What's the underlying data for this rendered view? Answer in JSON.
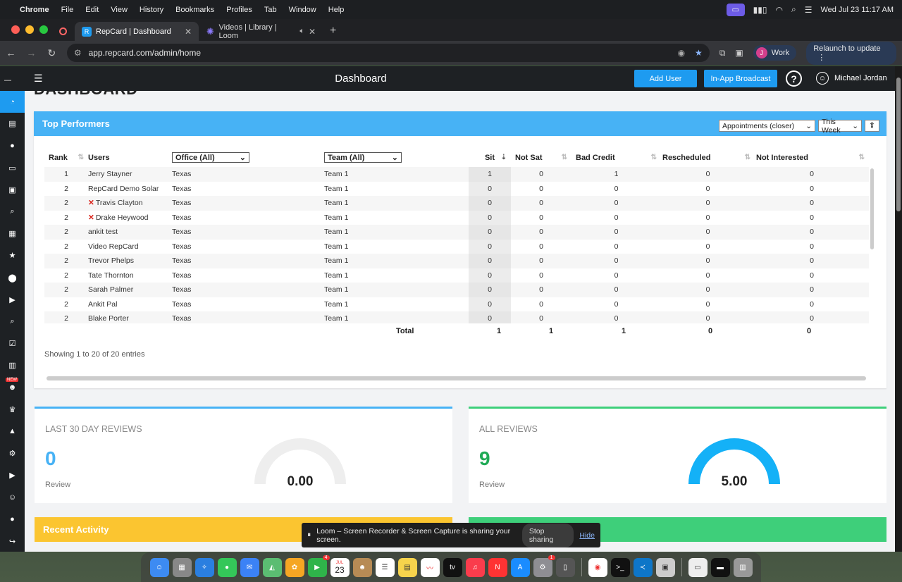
{
  "menubar": {
    "app": "Chrome",
    "items": [
      "File",
      "Edit",
      "View",
      "History",
      "Bookmarks",
      "Profiles",
      "Tab",
      "Window",
      "Help"
    ],
    "clock": "Wed Jul 23  11:17 AM"
  },
  "tabs": [
    {
      "title": "RepCard | Dashboard",
      "active": true
    },
    {
      "title": "Videos | Library | Loom",
      "active": false
    }
  ],
  "toolbar": {
    "url": "app.repcard.com/admin/home",
    "profile_initial": "J",
    "profile_name": "Work",
    "relaunch": "Relaunch to update"
  },
  "appbar": {
    "title": "Dashboard",
    "add_user": "Add User",
    "broadcast": "In-App Broadcast",
    "user_name": "Michael Jordan"
  },
  "sidebar": {
    "new_badge": "NEW"
  },
  "page": {
    "heading": "DASHBOARD"
  },
  "top_performers": {
    "title": "Top Performers",
    "metric_select": "Appointments (closer)",
    "period_select": "This Week",
    "columns": {
      "rank": "Rank",
      "users": "Users",
      "office": "Office (All)",
      "team": "Team (All)",
      "sit": "Sit",
      "not_sat": "Not Sat",
      "bad_credit": "Bad Credit",
      "rescheduled": "Rescheduled",
      "not_interested": "Not Interested"
    },
    "rows": [
      {
        "rank": "1",
        "user": "Jerry Stayner",
        "x": false,
        "office": "Texas",
        "team": "Team 1",
        "sit": "1",
        "not_sat": "0",
        "bad_credit": "1",
        "rescheduled": "0",
        "not_interested": "0"
      },
      {
        "rank": "2",
        "user": "RepCard Demo Solar",
        "x": false,
        "office": "Texas",
        "team": "Team 1",
        "sit": "0",
        "not_sat": "0",
        "bad_credit": "0",
        "rescheduled": "0",
        "not_interested": "0"
      },
      {
        "rank": "2",
        "user": "Travis Clayton",
        "x": true,
        "office": "Texas",
        "team": "Team 1",
        "sit": "0",
        "not_sat": "0",
        "bad_credit": "0",
        "rescheduled": "0",
        "not_interested": "0"
      },
      {
        "rank": "2",
        "user": "Drake Heywood",
        "x": true,
        "office": "Texas",
        "team": "Team 1",
        "sit": "0",
        "not_sat": "0",
        "bad_credit": "0",
        "rescheduled": "0",
        "not_interested": "0"
      },
      {
        "rank": "2",
        "user": "ankit test",
        "x": false,
        "office": "Texas",
        "team": "Team 1",
        "sit": "0",
        "not_sat": "0",
        "bad_credit": "0",
        "rescheduled": "0",
        "not_interested": "0"
      },
      {
        "rank": "2",
        "user": "Video RepCard",
        "x": false,
        "office": "Texas",
        "team": "Team 1",
        "sit": "0",
        "not_sat": "0",
        "bad_credit": "0",
        "rescheduled": "0",
        "not_interested": "0"
      },
      {
        "rank": "2",
        "user": "Trevor Phelps",
        "x": false,
        "office": "Texas",
        "team": "Team 1",
        "sit": "0",
        "not_sat": "0",
        "bad_credit": "0",
        "rescheduled": "0",
        "not_interested": "0"
      },
      {
        "rank": "2",
        "user": "Tate Thornton",
        "x": false,
        "office": "Texas",
        "team": "Team 1",
        "sit": "0",
        "not_sat": "0",
        "bad_credit": "0",
        "rescheduled": "0",
        "not_interested": "0"
      },
      {
        "rank": "2",
        "user": "Sarah Palmer",
        "x": false,
        "office": "Texas",
        "team": "Team 1",
        "sit": "0",
        "not_sat": "0",
        "bad_credit": "0",
        "rescheduled": "0",
        "not_interested": "0"
      },
      {
        "rank": "2",
        "user": "Ankit Pal",
        "x": false,
        "office": "Texas",
        "team": "Team 1",
        "sit": "0",
        "not_sat": "0",
        "bad_credit": "0",
        "rescheduled": "0",
        "not_interested": "0"
      },
      {
        "rank": "2",
        "user": "Blake Porter",
        "x": false,
        "office": "Texas",
        "team": "Team 1",
        "sit": "0",
        "not_sat": "0",
        "bad_credit": "0",
        "rescheduled": "0",
        "not_interested": "0"
      }
    ],
    "totals": {
      "label": "Total",
      "sit": "1",
      "not_sat": "1",
      "bad_credit": "1",
      "rescheduled": "0",
      "not_interested": "0"
    },
    "showing": "Showing 1 to 20 of 20 entries"
  },
  "reviews": {
    "last30": {
      "label": "LAST 30 DAY REVIEWS",
      "count": "0",
      "sub": "Review",
      "score": "0.00",
      "gauge_fraction": 0,
      "color": "#47b2f5"
    },
    "all": {
      "label": "ALL REVIEWS",
      "count": "9",
      "sub": "Review",
      "score": "5.00",
      "gauge_fraction": 1,
      "color": "#1faa55"
    }
  },
  "recent_activity": {
    "title": "Recent Activity"
  },
  "loom": {
    "message": "Loom – Screen Recorder & Screen Capture is sharing your screen.",
    "stop": "Stop sharing",
    "hide": "Hide"
  },
  "dock": {
    "calendar_month": "JUL",
    "calendar_day": "23",
    "facetime_badge": "4",
    "settings_badge": "1"
  }
}
